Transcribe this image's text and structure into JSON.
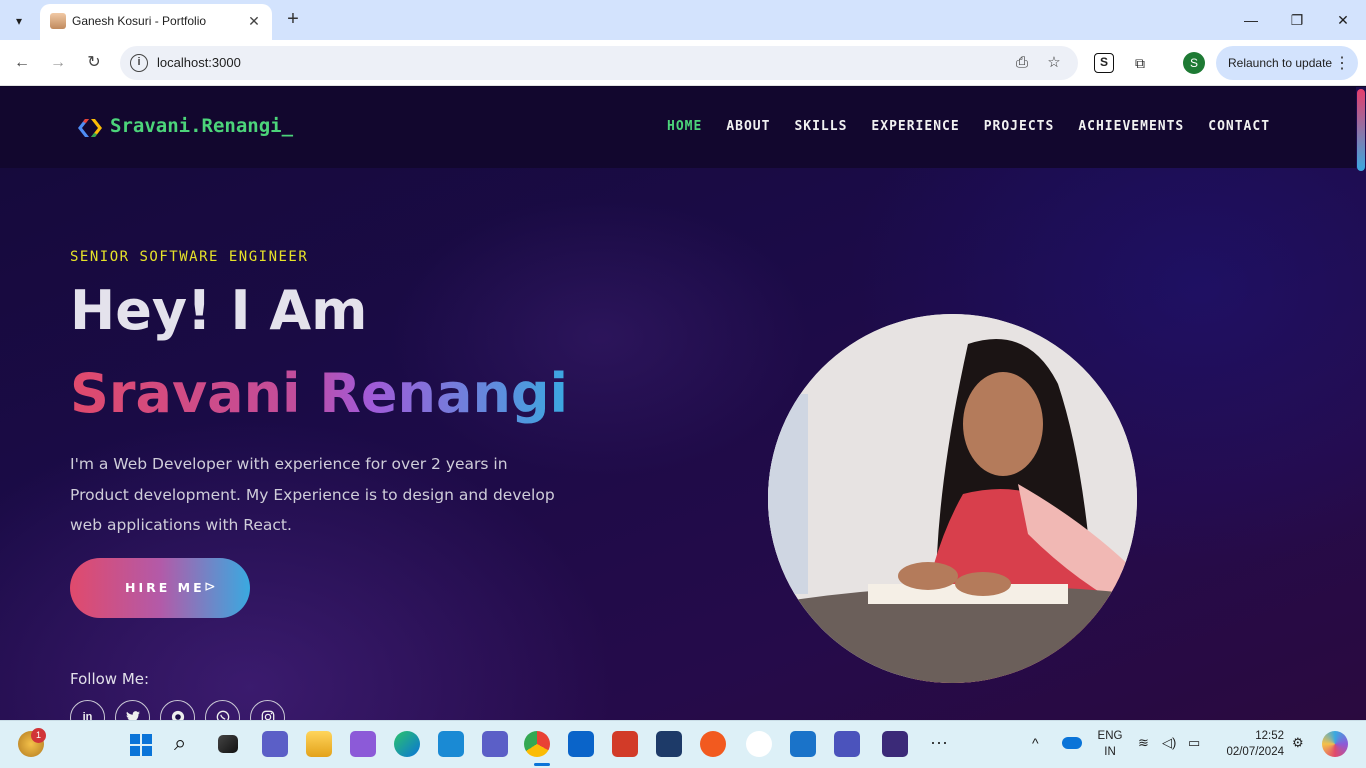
{
  "browser": {
    "tab_title": "Ganesh Kosuri - Portfolio",
    "url": "localhost:3000",
    "relaunch_label": "Relaunch to update",
    "profile_initial": "S",
    "extension_label": "S"
  },
  "site": {
    "logo_text": "Sravani.Renangi_",
    "nav": [
      "HOME",
      "ABOUT",
      "SKILLS",
      "EXPERIENCE",
      "PROJECTS",
      "ACHIEVEMENTS",
      "CONTACT"
    ],
    "active_nav": "HOME",
    "hero": {
      "subtitle": "SENIOR SOFTWARE ENGINEER",
      "title": "Hey! I Am",
      "name": "Sravani Renangi",
      "description": "I'm a Web Developer with experience for over 2 years in Product development. My Experience is to design and develop web applications with React.",
      "cta_label": "HIRE ME",
      "follow_label": "Follow Me:"
    },
    "socials": [
      {
        "name": "linkedin-icon",
        "glyph": "in"
      },
      {
        "name": "twitter-icon",
        "glyph": "🐦"
      },
      {
        "name": "github-icon",
        "glyph": "●"
      },
      {
        "name": "whatsapp-icon",
        "glyph": "✆"
      },
      {
        "name": "instagram-icon",
        "glyph": "◎"
      }
    ]
  },
  "taskbar": {
    "notification_badge": "1",
    "language_line1": "ENG",
    "language_line2": "IN",
    "time": "12:52",
    "date": "02/07/2024"
  }
}
